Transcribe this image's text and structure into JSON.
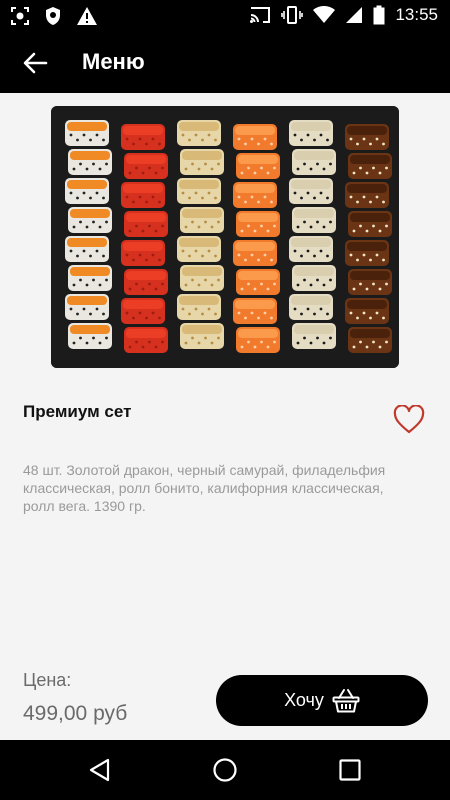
{
  "status_bar": {
    "time": "13:55",
    "icons": [
      "screenshot-icon",
      "shield-icon",
      "warning-icon",
      "cast-icon",
      "vibrate-icon",
      "wifi-icon",
      "signal-icon",
      "battery-icon"
    ]
  },
  "app_bar": {
    "title": "Меню",
    "back_icon": "arrow-left-icon"
  },
  "product": {
    "image_icon": "sushi-set-photo",
    "name": "Премиум сет",
    "favorite_icon": "heart-outline-icon",
    "favorite_color": "#c0392b",
    "description": "48 шт. Золотой дракон, черный самурай, филадельфия классическая, ролл бонито, калифорния классическая, ролл вега. 1390 гр."
  },
  "price": {
    "label": "Цена:",
    "value": "499,00 руб"
  },
  "cta": {
    "label": "Хочу",
    "icon": "basket-icon"
  },
  "nav_bar": {
    "back_icon": "triangle-back-icon",
    "home_icon": "circle-home-icon",
    "recents_icon": "square-recents-icon"
  }
}
